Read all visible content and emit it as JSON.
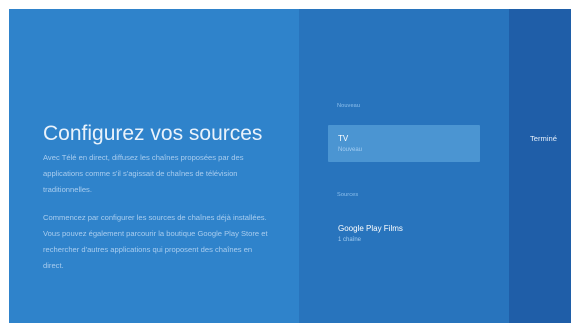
{
  "setup": {
    "title": "Configurez vos sources",
    "description_1": "Avec Télé en direct, diffusez les chaînes proposées par des applications comme s'il s'agissait de chaînes de télévision traditionnelles.",
    "description_2": "Commencez par configurer les sources de chaînes déjà installées. Vous pouvez également parcourir la boutique Google Play Store et rechercher d'autres applications qui proposent des chaînes en direct."
  },
  "sections": {
    "new": {
      "label": "Nouveau",
      "items": [
        {
          "title": "TV",
          "subtitle": "Nouveau",
          "selected": true
        }
      ]
    },
    "sources": {
      "label": "Sources",
      "items": [
        {
          "title": "Google Play Films",
          "subtitle": "1 chaîne",
          "selected": false
        }
      ]
    }
  },
  "actions": {
    "done_label": "Terminé"
  },
  "colors": {
    "left_pane": "#2f83cb",
    "middle_pane": "#2874bd",
    "right_pane": "#1f5ea8",
    "selected_card": "#4b95d2"
  }
}
